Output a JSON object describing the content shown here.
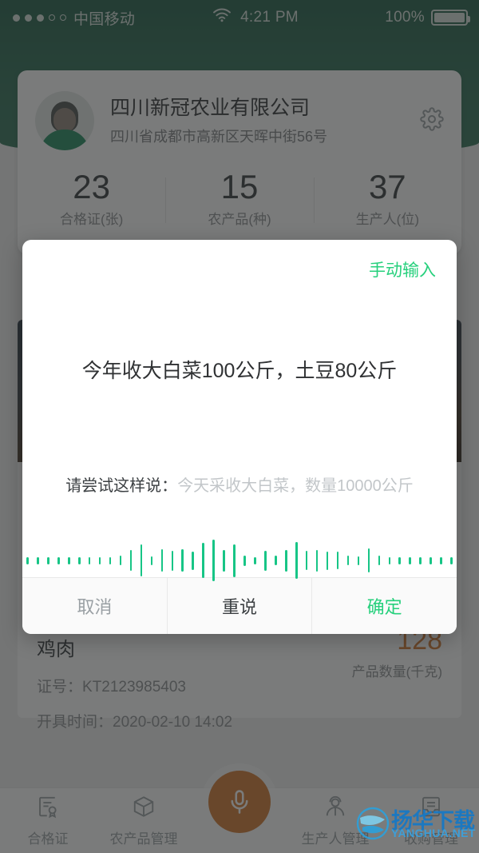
{
  "status_bar": {
    "carrier": "中国移动",
    "signal_dots": [
      true,
      true,
      true,
      false,
      false
    ],
    "wifi_icon": "wifi-icon",
    "time": "4:21 PM",
    "battery_percent": "100%",
    "battery_icon": "battery-full-icon"
  },
  "company_card": {
    "avatar_icon": "user-avatar",
    "name": "四川新冠农业有限公司",
    "address": "四川省成都市高新区天晖中街56号",
    "settings_icon": "gear-icon",
    "stats": [
      {
        "value": "23",
        "label": "合格证(张)"
      },
      {
        "value": "15",
        "label": "农产品(种)"
      },
      {
        "value": "37",
        "label": "生产人(位)"
      }
    ]
  },
  "certificate_card": {
    "product": "鸡肉",
    "cert_no_label": "证号：",
    "cert_no": "KT2123985403",
    "issue_label": "开具时间：",
    "issue_time": "2020-02-10 14:02",
    "quantity": "128",
    "quantity_label": "产品数量(千克)"
  },
  "voice_dialog": {
    "manual_input_label": "手动输入",
    "recognized_text": "今年收大白菜100公斤，土豆80公斤",
    "hint_lead": "请尝试这样说：",
    "hint_example": "今天采收大白菜，数量10000公斤",
    "waveform_icon": "audio-waveform",
    "waveform_heights": [
      9,
      9,
      9,
      9,
      9,
      9,
      9,
      9,
      9,
      12,
      26,
      40,
      11,
      28,
      25,
      28,
      23,
      44,
      52,
      27,
      41,
      13,
      9,
      25,
      12,
      27,
      46,
      24,
      27,
      23,
      22,
      12,
      11,
      30,
      12,
      9,
      9,
      9,
      9,
      9,
      9,
      9
    ],
    "buttons": [
      {
        "label": "取消",
        "name": "cancel"
      },
      {
        "label": "重说",
        "name": "redo"
      },
      {
        "label": "确定",
        "name": "confirm"
      }
    ],
    "accent_color": "#26d07c",
    "wave_color": "#17c586"
  },
  "tab_bar": {
    "items": [
      {
        "label": "合格证",
        "icon": "certificate-icon"
      },
      {
        "label": "农产品管理",
        "icon": "box-icon"
      },
      {
        "label": "",
        "icon": "microphone-icon"
      },
      {
        "label": "生产人管理",
        "icon": "worker-icon"
      },
      {
        "label": "收购管理",
        "icon": "inbox-icon"
      }
    ]
  },
  "watermark": {
    "title": "扬华下载",
    "subtitle": "YANGHUA.NET"
  }
}
